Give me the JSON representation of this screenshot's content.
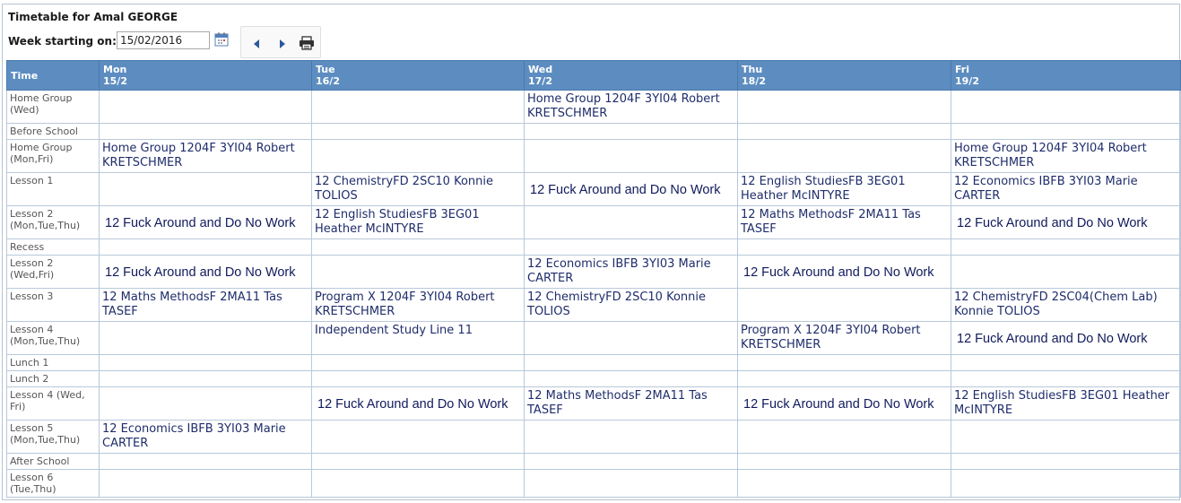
{
  "title": "Timetable for Amal GEORGE",
  "week": {
    "label": "Week starting on:",
    "value": "15/02/2016"
  },
  "icons": [
    "calendar-icon",
    "arrow-left-icon",
    "arrow-right-icon",
    "printer-icon"
  ],
  "colors": {
    "header_bg": "#5d8dc0",
    "header_text": "#ffffff",
    "cell_text": "#1f2d6b",
    "grid": "#b8c8da"
  },
  "table": {
    "time_header": "Time",
    "days": [
      {
        "name": "Mon",
        "date": "15/2"
      },
      {
        "name": "Tue",
        "date": "16/2"
      },
      {
        "name": "Wed",
        "date": "17/2"
      },
      {
        "name": "Thu",
        "date": "18/2"
      },
      {
        "name": "Fri",
        "date": "19/2"
      }
    ],
    "rows": [
      {
        "time": "Home Group (Wed)",
        "cells": [
          "",
          "",
          "Home Group 1204F 3YI04 Robert KRETSCHMER",
          "",
          ""
        ]
      },
      {
        "time": "Before School",
        "cells": [
          "",
          "",
          "",
          "",
          ""
        ]
      },
      {
        "time": "Home Group (Mon,Fri)",
        "cells": [
          "Home Group 1204F 3YI04 Robert KRETSCHMER",
          "",
          "",
          "",
          "Home Group 1204F 3YI04 Robert KRETSCHMER"
        ]
      },
      {
        "time": "Lesson 1",
        "cells": [
          "",
          "12 ChemistryFD 2SC10 Konnie TOLIOS",
          "12 Fuck Around and Do No Work",
          "12 English StudiesFB 3EG01 Heather McINTYRE",
          "12 Economics IBFB 3YI03 Marie CARTER"
        ]
      },
      {
        "time": "Lesson 2 (Mon,Tue,Thu)",
        "cells": [
          "12 Fuck Around and Do No Work",
          "12 English StudiesFB 3EG01 Heather McINTYRE",
          "",
          "12 Maths MethodsF 2MA11 Tas TASEF",
          "12 Fuck Around and Do No Work"
        ]
      },
      {
        "time": "Recess",
        "cells": [
          "",
          "",
          "",
          "",
          ""
        ]
      },
      {
        "time": "Lesson 2 (Wed,Fri)",
        "cells": [
          "12 Fuck Around and Do No Work",
          "",
          "12 Economics IBFB 3YI03 Marie CARTER",
          "12 Fuck Around and Do No Work",
          ""
        ]
      },
      {
        "time": "Lesson 3",
        "cells": [
          "12 Maths MethodsF 2MA11 Tas TASEF",
          "Program X 1204F 3YI04 Robert KRETSCHMER",
          "12 ChemistryFD 2SC10 Konnie TOLIOS",
          "",
          "12 ChemistryFD 2SC04(Chem Lab) Konnie TOLIOS"
        ]
      },
      {
        "time": "Lesson 4 (Mon,Tue,Thu)",
        "cells": [
          "",
          "Independent Study Line 11",
          "",
          "Program X 1204F 3YI04 Robert KRETSCHMER",
          "12 Fuck Around and Do No Work"
        ]
      },
      {
        "time": "Lunch 1",
        "cells": [
          "",
          "",
          "",
          "",
          ""
        ]
      },
      {
        "time": "Lunch 2",
        "cells": [
          "",
          "",
          "",
          "",
          ""
        ]
      },
      {
        "time": "Lesson 4 (Wed, Fri)",
        "cells": [
          "",
          "12 Fuck Around and Do No Work",
          "12 Maths MethodsF 2MA11 Tas TASEF",
          "12 Fuck Around and Do No Work",
          "12 English StudiesFB 3EG01 Heather McINTYRE"
        ]
      },
      {
        "time": "Lesson 5 (Mon,Tue,Thu)",
        "cells": [
          "12 Economics IBFB 3YI03 Marie CARTER",
          "",
          "",
          "",
          ""
        ]
      },
      {
        "time": "After School",
        "cells": [
          "",
          "",
          "",
          "",
          ""
        ]
      },
      {
        "time": "Lesson 6 (Tue,Thu)",
        "cells": [
          "",
          "",
          "",
          "",
          ""
        ]
      }
    ]
  }
}
